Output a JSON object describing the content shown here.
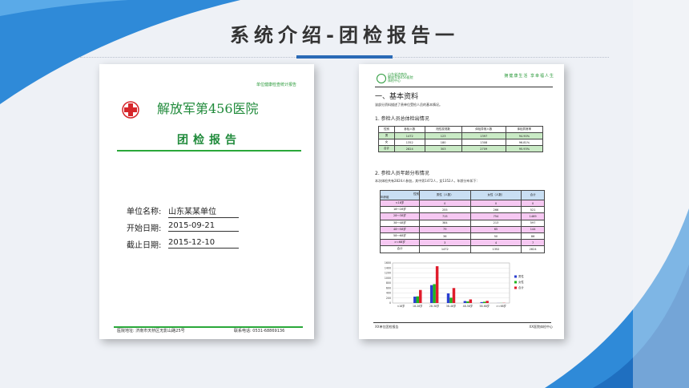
{
  "page": {
    "title": "系统介绍-团检报告一",
    "colors": {
      "accent_blue": "#2a6ab6",
      "green": "#1f8a3a",
      "pink_row": "#f6c8f2",
      "green_row": "#c9eac5",
      "blue_header": "#c9dff3"
    }
  },
  "left_doc": {
    "report_type": "单位健康检查统计报告",
    "hospital": "解放军第456医院",
    "heading": "团检报告",
    "fields": [
      {
        "label": "单位名称:",
        "value": "山东某某单位"
      },
      {
        "label": "开始日期:",
        "value": "2015-09-21"
      },
      {
        "label": "截止日期:",
        "value": "2015-12-10"
      }
    ],
    "footer_address": "医院地址: 济南市天桥区无影山路25号",
    "footer_phone": "联系电话: 0531-68869136"
  },
  "right_doc": {
    "header_lines": [
      "山东省济南市",
      "解放军第456医院",
      "体检中心"
    ],
    "slogan": "拥健康生活 享幸福人生",
    "section_title": "一、基本资料",
    "intro": "该部分资料描述了贵单位受检人员的基本情况。",
    "sub1": "1. 参检人员总体检出情况",
    "table1": {
      "headers": [
        "性别",
        "参检人数",
        "阳性发现数",
        "体检异常人数",
        "体检异常率"
      ],
      "rows": [
        [
          "男",
          "1472",
          "123",
          "1397",
          "94.90%"
        ],
        [
          "女",
          "1352",
          "180",
          "1308",
          "96.81%"
        ],
        [
          "合计",
          "2824",
          "303",
          "2709",
          "95.93%"
        ]
      ]
    },
    "sub2": "2. 参检人员年龄分布情况",
    "intro2": "本次体检共有2824人参加，其中男1472人，女1352人，年龄分布如下：",
    "table2": {
      "corner_top": "性别",
      "corner_bottom": "年龄组",
      "headers": [
        "男性（人数）",
        "女性（人数）",
        "合计"
      ],
      "rows": [
        [
          "<18岁",
          "0",
          "0",
          "0"
        ],
        [
          "18～28岁",
          "255",
          "266",
          "521"
        ],
        [
          "28～38岁",
          "715",
          "754",
          "1469"
        ],
        [
          "38～48岁",
          "384",
          "213",
          "597"
        ],
        [
          "48～58岁",
          "79",
          "65",
          "144"
        ],
        [
          "58～68岁",
          "36",
          "50",
          "86"
        ],
        [
          ">=68岁",
          "3",
          "4",
          "7"
        ],
        [
          "合计",
          "1472",
          "1352",
          "2824"
        ]
      ]
    },
    "footer_left": "XX单位团检报告",
    "footer_right": "XX医院体检中心"
  },
  "chart_data": {
    "type": "bar",
    "categories": [
      "<18岁",
      "18-28岁",
      "28-38岁",
      "38-48岁",
      "48-58岁",
      "58-68岁",
      ">=68岁"
    ],
    "series": [
      {
        "name": "男性",
        "color": "#2b3fd1",
        "values": [
          0,
          255,
          715,
          384,
          79,
          36,
          3
        ]
      },
      {
        "name": "女性",
        "color": "#1fb51f",
        "values": [
          0,
          266,
          754,
          213,
          65,
          50,
          4
        ]
      },
      {
        "name": "合计",
        "color": "#e01c2c",
        "values": [
          0,
          521,
          1469,
          597,
          144,
          86,
          7
        ]
      }
    ],
    "yticks": [
      "0",
      "200",
      "400",
      "600",
      "800",
      "1000",
      "1200",
      "1400",
      "1600"
    ],
    "ylim": [
      0,
      1600
    ],
    "legend": "right",
    "grid": true
  }
}
